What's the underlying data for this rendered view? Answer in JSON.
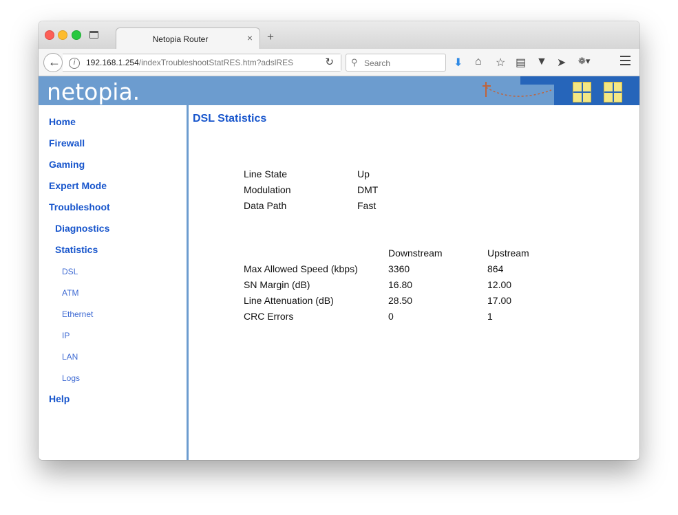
{
  "browser": {
    "tab_title": "Netopia Router",
    "tab_close": "×",
    "new_tab": "+",
    "url_host": "192.168.1.254",
    "url_path": "/indexTroubleshootStatRES.htm?adslRES",
    "search_placeholder": "Search"
  },
  "banner": {
    "logo": "netopia."
  },
  "sidebar": {
    "home": "Home",
    "firewall": "Firewall",
    "gaming": "Gaming",
    "expert_mode": "Expert Mode",
    "troubleshoot": "Troubleshoot",
    "diagnostics": "Diagnostics",
    "statistics": "Statistics",
    "dsl": "DSL",
    "atm": "ATM",
    "ethernet": "Ethernet",
    "ip": "IP",
    "lan": "LAN",
    "logs": "Logs",
    "help": "Help"
  },
  "main": {
    "title": "DSL Statistics",
    "status": [
      {
        "label": "Line State",
        "value": "Up"
      },
      {
        "label": "Modulation",
        "value": "DMT"
      },
      {
        "label": "Data Path",
        "value": "Fast"
      }
    ],
    "stats_headers": {
      "downstream": "Downstream",
      "upstream": "Upstream"
    },
    "stats": [
      {
        "label": "Max Allowed Speed (kbps)",
        "downstream": "3360",
        "upstream": "864"
      },
      {
        "label": "SN Margin (dB)",
        "downstream": "16.80",
        "upstream": "12.00"
      },
      {
        "label": "Line Attenuation (dB)",
        "downstream": "28.50",
        "upstream": "17.00"
      },
      {
        "label": "CRC Errors",
        "downstream": "0",
        "upstream": "1"
      }
    ]
  }
}
